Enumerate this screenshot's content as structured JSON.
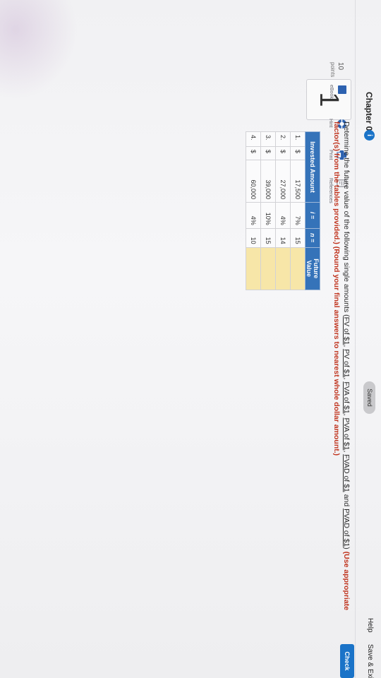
{
  "header": {
    "chapter": "Chapter 06",
    "chapter_info_icon": "i",
    "status": "Saved",
    "help": "Help",
    "save_exit": "Save & Exit",
    "check": "Check"
  },
  "question": {
    "number": "1",
    "points_value": "10",
    "points_label": "points",
    "prompt_start": "Determine the future value of the following single amounts (",
    "links": [
      "FV of $1",
      "PV of $1",
      "FVA of $1",
      "PVA of $1",
      "FVAD of $1",
      "PVAD of $1"
    ],
    "prompt_and": "and",
    "prompt_close": ")",
    "instruction": "(Use appropriate factor(s) from the tables provided.) (Round your final answers to nearest whole dollar amount.)"
  },
  "tools": [
    {
      "icon": "ebook-icon",
      "label": "eBook"
    },
    {
      "icon": "hint-icon",
      "label": "Hint"
    },
    {
      "icon": "print-icon",
      "label": "Print"
    },
    {
      "icon": "references-icon",
      "label": "References"
    }
  ],
  "table": {
    "headers": [
      "Invested Amount",
      "i =",
      "n =",
      "Future Value"
    ],
    "rows": [
      {
        "num": "1.",
        "dollar": "$",
        "amount": "17,500",
        "i": "7%",
        "n": "15",
        "fv": ""
      },
      {
        "num": "2.",
        "dollar": "$",
        "amount": "27,000",
        "i": "4%",
        "n": "14",
        "fv": ""
      },
      {
        "num": "3.",
        "dollar": "$",
        "amount": "39,000",
        "i": "10%",
        "n": "15",
        "fv": ""
      },
      {
        "num": "4.",
        "dollar": "$",
        "amount": "60,000",
        "i": "4%",
        "n": "10",
        "fv": ""
      }
    ]
  },
  "colors": {
    "accent": "#1a73c8",
    "table_header": "#3573b9",
    "answer_cell": "#f7e6a8",
    "instruction_red": "#c0341e"
  }
}
